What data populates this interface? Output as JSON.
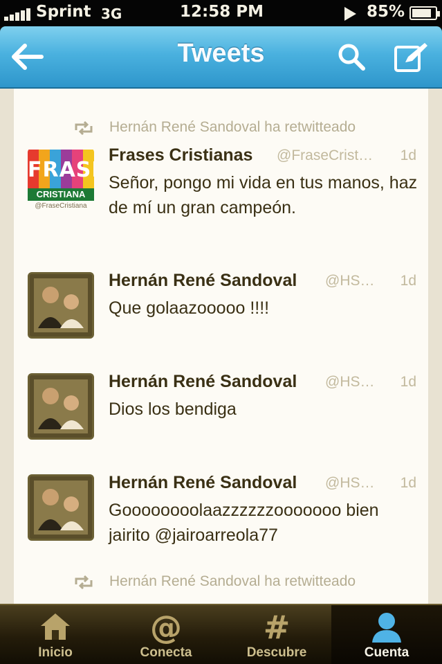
{
  "status_bar": {
    "carrier": "Sprint",
    "network": "3G",
    "time": "12:58 PM",
    "battery": "85%",
    "battery_level": 0.85
  },
  "nav": {
    "title": "Tweets",
    "back_icon": "back-arrow-icon",
    "search_icon": "search-icon",
    "compose_icon": "compose-icon"
  },
  "timeline": {
    "retweet_banner_1": "Hernán René Sandoval ha retwitteado",
    "retweet_banner_2": "Hernán René Sandoval ha retwitteado",
    "tweets": [
      {
        "author": "Frases Cristianas",
        "handle": "@FraseCrist…",
        "time": "1d",
        "text": "Señor, pongo mi vida en tus manos, haz de mí un gran campeón.",
        "avatar": {
          "logo_text": "FRASE",
          "logo_subtext": "CRISTIANA",
          "logo_handle": "@FraseCristiana"
        }
      },
      {
        "author": "Hernán René Sandoval",
        "handle": "@HS…",
        "time": "1d",
        "text": "Que golaazooooo !!!!"
      },
      {
        "author": "Hernán René Sandoval",
        "handle": "@HS…",
        "time": "1d",
        "text": "Dios los bendiga"
      },
      {
        "author": "Hernán René Sandoval",
        "handle": "@HS…",
        "time": "1d",
        "text": "Goooooooolaazzzzzzooooooo bien jairito @jairoarreola77"
      }
    ]
  },
  "tab_bar": {
    "tabs": [
      {
        "label": "Inicio",
        "icon": "home-icon"
      },
      {
        "label": "Conecta",
        "icon": "at-icon"
      },
      {
        "label": "Descubre",
        "icon": "hash-icon"
      },
      {
        "label": "Cuenta",
        "icon": "person-icon",
        "active": true
      }
    ]
  },
  "colors": {
    "nav_blue": "#4ab1df",
    "text_dark": "#3a3014",
    "text_muted": "#c2b99d",
    "tab_bar": "#241c0a"
  }
}
